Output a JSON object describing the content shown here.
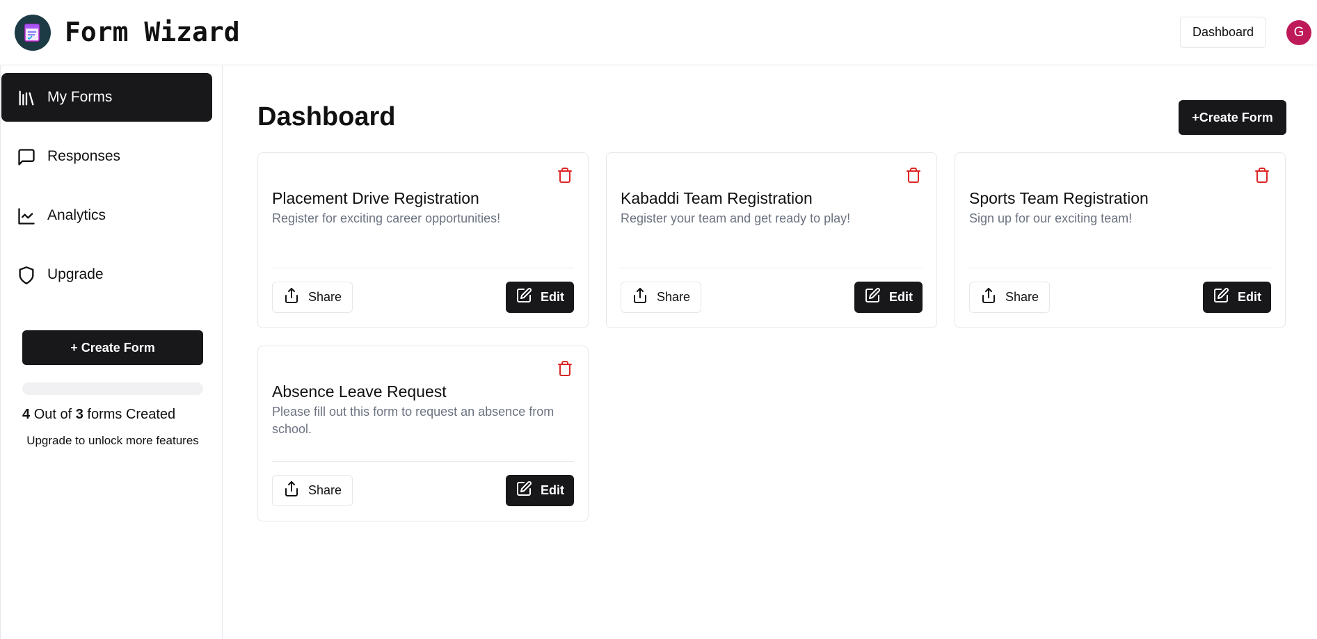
{
  "header": {
    "app_title": "Form Wizard",
    "dashboard_button": "Dashboard",
    "avatar_initial": "G",
    "avatar_color": "#be1a5a"
  },
  "sidebar": {
    "items": [
      {
        "label": "My Forms",
        "icon": "library-icon",
        "active": true
      },
      {
        "label": "Responses",
        "icon": "message-square-icon",
        "active": false
      },
      {
        "label": "Analytics",
        "icon": "line-chart-icon",
        "active": false
      },
      {
        "label": "Upgrade",
        "icon": "shield-icon",
        "active": false
      }
    ],
    "create_button": "+ Create Form",
    "usage": {
      "created": "4",
      "text_mid": "Out of",
      "limit": "3",
      "text_end": "forms Created",
      "progress_fraction": 0
    },
    "upgrade_note": "Upgrade to unlock more features"
  },
  "main": {
    "title": "Dashboard",
    "create_button": "+Create Form",
    "share_label": "Share",
    "edit_label": "Edit",
    "cards": [
      {
        "title": "Placement Drive Registration",
        "description": "Register for exciting career opportunities!"
      },
      {
        "title": "Kabaddi Team Registration",
        "description": "Register your team and get ready to play!"
      },
      {
        "title": "Sports Team Registration",
        "description": "Sign up for our exciting team!"
      },
      {
        "title": "Absence Leave Request",
        "description": "Please fill out this form to request an absence from school."
      }
    ]
  },
  "colors": {
    "primary": "#18181b",
    "delete": "#dc2626",
    "muted_text": "#6b7280",
    "border": "#e5e7eb"
  }
}
